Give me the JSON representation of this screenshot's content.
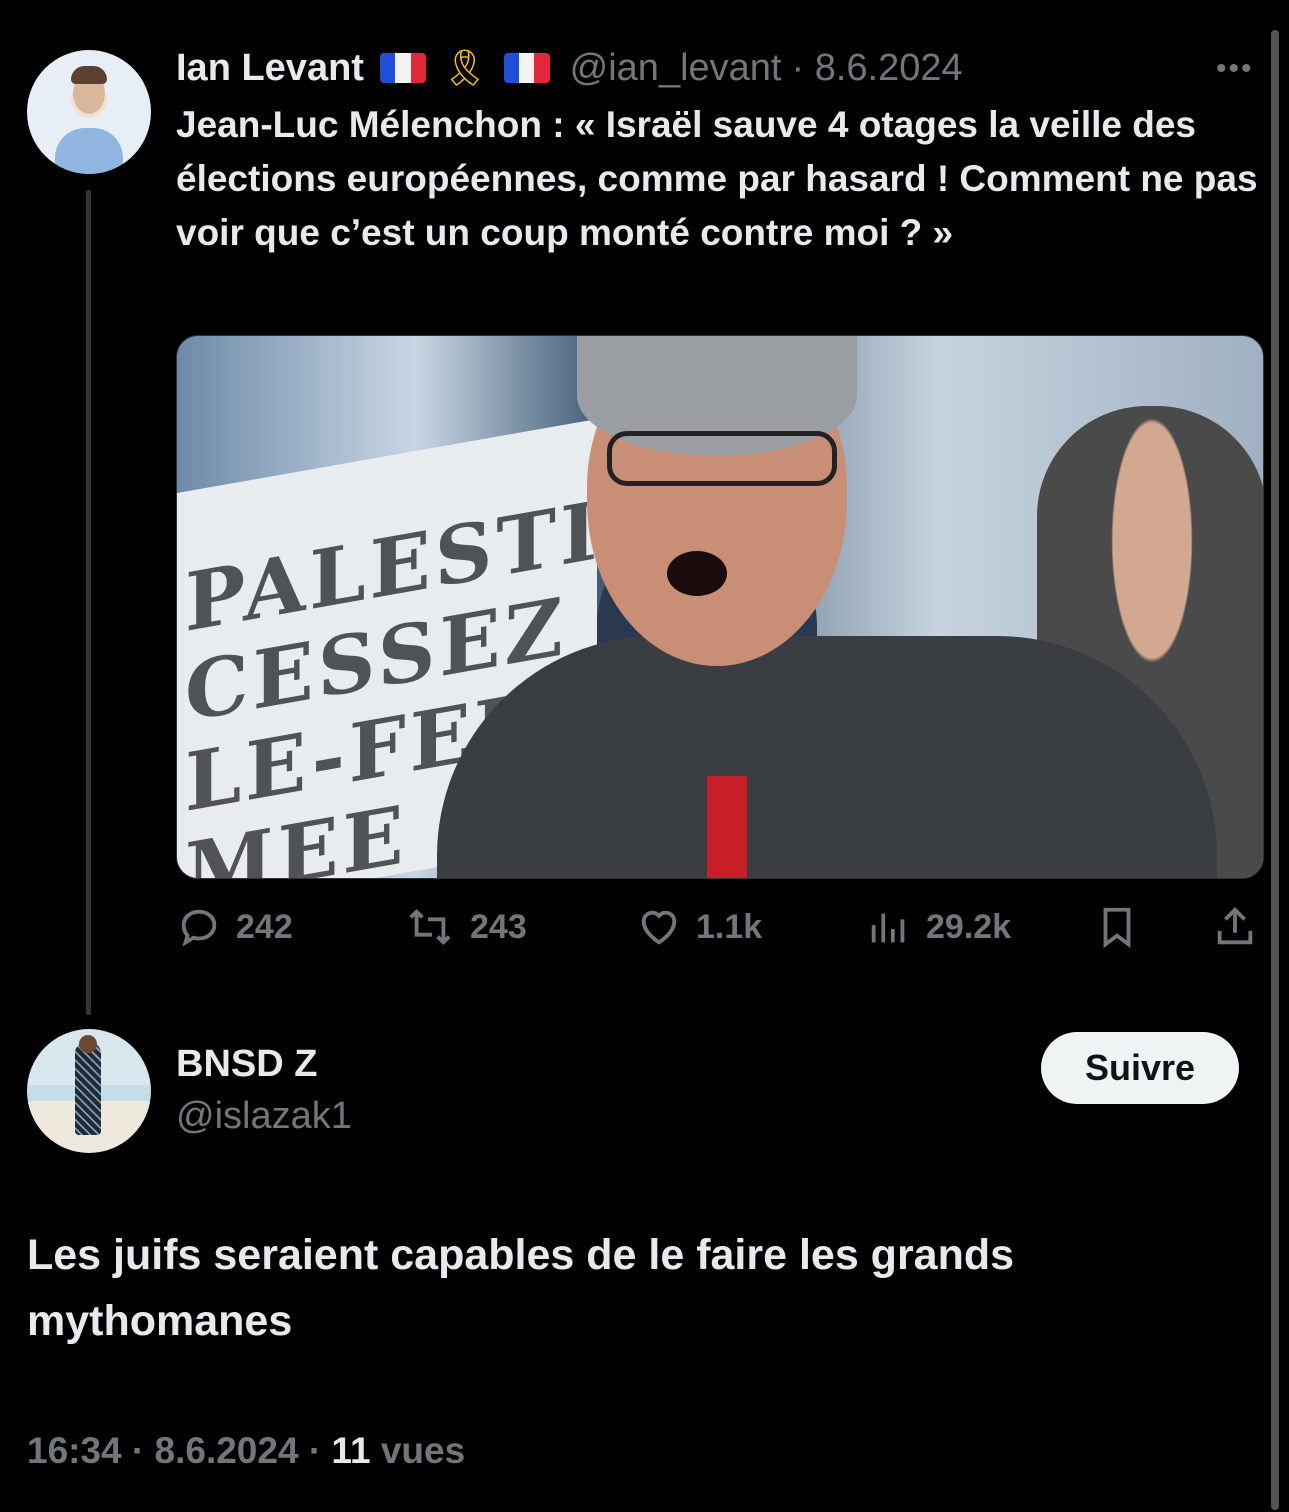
{
  "quoted_tweet": {
    "author_name": "Ian Levant",
    "badges": [
      "flag-france-icon",
      "yellow-ribbon-icon",
      "flag-france-icon"
    ],
    "handle": "@ian_levant",
    "date": "· 8.6.2024",
    "text": "Jean-Luc Mélenchon : « Israël sauve 4 otages la veille des élections européennes, comme par hasard ! Comment ne pas voir que c’est un coup monté contre moi ? »",
    "media_banner_text": "...PALESTINE CESSEZ LE-FEU MEE",
    "stats": {
      "replies": "242",
      "retweets": "243",
      "likes": "1.1k",
      "views": "29.2k"
    }
  },
  "reply": {
    "author_name": "BNSD Z",
    "handle": "@islazak1",
    "follow_label": "Suivre",
    "text": "Les juifs seraient capables de le faire les grands mythomanes",
    "time": "16:34 · 8.6.2024 · ",
    "views_count": "11",
    "views_label": " vues"
  },
  "colors": {
    "background": "#000000",
    "text": "#e7e9ea",
    "secondary_text": "#71767b",
    "follow_button_bg": "#eff3f4"
  }
}
